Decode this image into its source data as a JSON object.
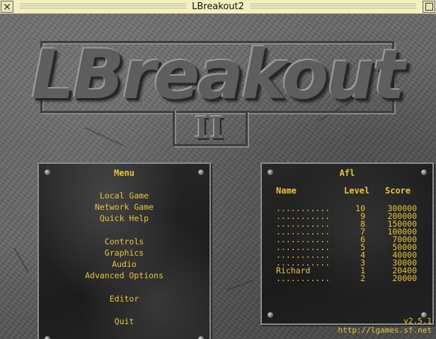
{
  "window": {
    "title": "LBreakout2"
  },
  "logo": {
    "text": "LBreakout",
    "subtitle": "II"
  },
  "menu": {
    "title": "Menu",
    "items": [
      "Local Game",
      "Network Game",
      "Quick Help",
      "Controls",
      "Graphics",
      "Audio",
      "Advanced Options",
      "Editor",
      "Quit"
    ]
  },
  "highscores": {
    "title": "Afl",
    "headers": {
      "name": "Name",
      "level": "Level",
      "score": "Score"
    },
    "rows": [
      {
        "name": "...........",
        "level": "10",
        "score": "300000"
      },
      {
        "name": "...........",
        "level": "9",
        "score": "200000"
      },
      {
        "name": "...........",
        "level": "8",
        "score": "150000"
      },
      {
        "name": "...........",
        "level": "7",
        "score": "100000"
      },
      {
        "name": "...........",
        "level": "6",
        "score": "70000"
      },
      {
        "name": "...........",
        "level": "5",
        "score": "50000"
      },
      {
        "name": "...........",
        "level": "4",
        "score": "40000"
      },
      {
        "name": "...........",
        "level": "3",
        "score": "30000"
      },
      {
        "name": "Richard",
        "level": "1",
        "score": "20400"
      },
      {
        "name": "...........",
        "level": "2",
        "score": "20000"
      }
    ]
  },
  "footer": {
    "version": "v2.5.1",
    "url": "http://lgames.sf.net"
  },
  "colors": {
    "text": "#e8c43a",
    "titlebar": "#f3efc0"
  }
}
